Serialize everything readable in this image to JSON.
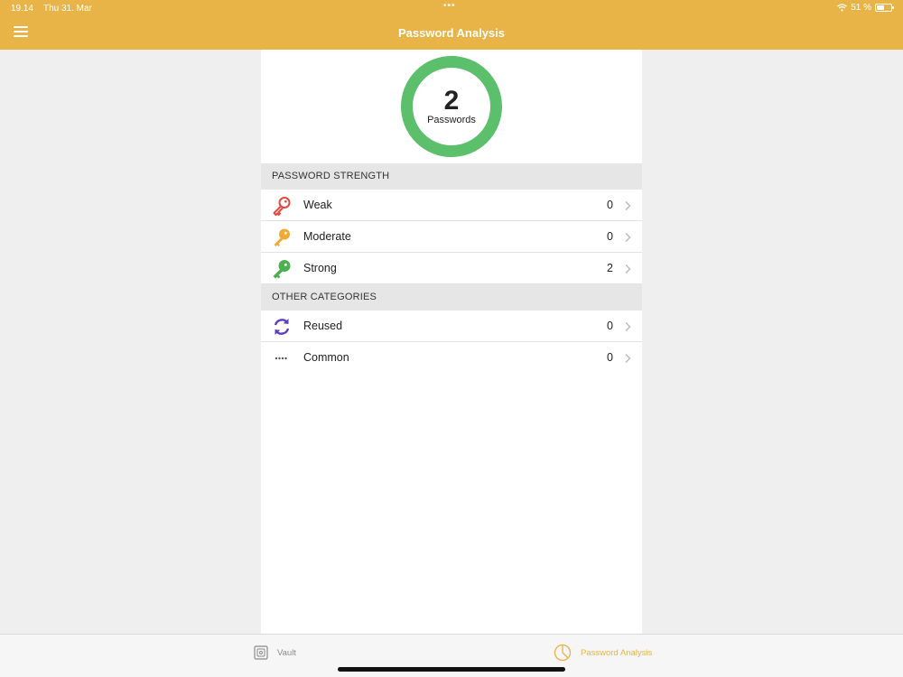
{
  "status_bar": {
    "time": "19.14",
    "date": "Thu 31. Mar",
    "dots": "•••",
    "battery_text": "51 %"
  },
  "header": {
    "title": "Password Analysis",
    "accent_color": "#e9b447"
  },
  "summary": {
    "count": "2",
    "label": "Passwords",
    "ring_color": "#5bbf6b"
  },
  "sections": {
    "strength": {
      "title": "PASSWORD STRENGTH",
      "rows": [
        {
          "label": "Weak",
          "value": "0",
          "icon": "key-icon",
          "color": "#e04a3f"
        },
        {
          "label": "Moderate",
          "value": "0",
          "icon": "key-icon",
          "color": "#f0a932"
        },
        {
          "label": "Strong",
          "value": "2",
          "icon": "key-icon",
          "color": "#4caf50"
        }
      ]
    },
    "other": {
      "title": "OTHER CATEGORIES",
      "rows": [
        {
          "label": "Reused",
          "value": "0",
          "icon": "refresh-icon",
          "color": "#5b3fbf"
        },
        {
          "label": "Common",
          "value": "0",
          "icon": "dots-icon",
          "color": "#555555"
        }
      ]
    }
  },
  "tabbar": {
    "tabs": [
      {
        "label": "Vault",
        "icon": "vault-icon",
        "active": false
      },
      {
        "label": "Password Analysis",
        "icon": "analysis-icon",
        "active": true
      }
    ],
    "active_color": "#e9b447",
    "inactive_color": "#8a8a8a"
  }
}
